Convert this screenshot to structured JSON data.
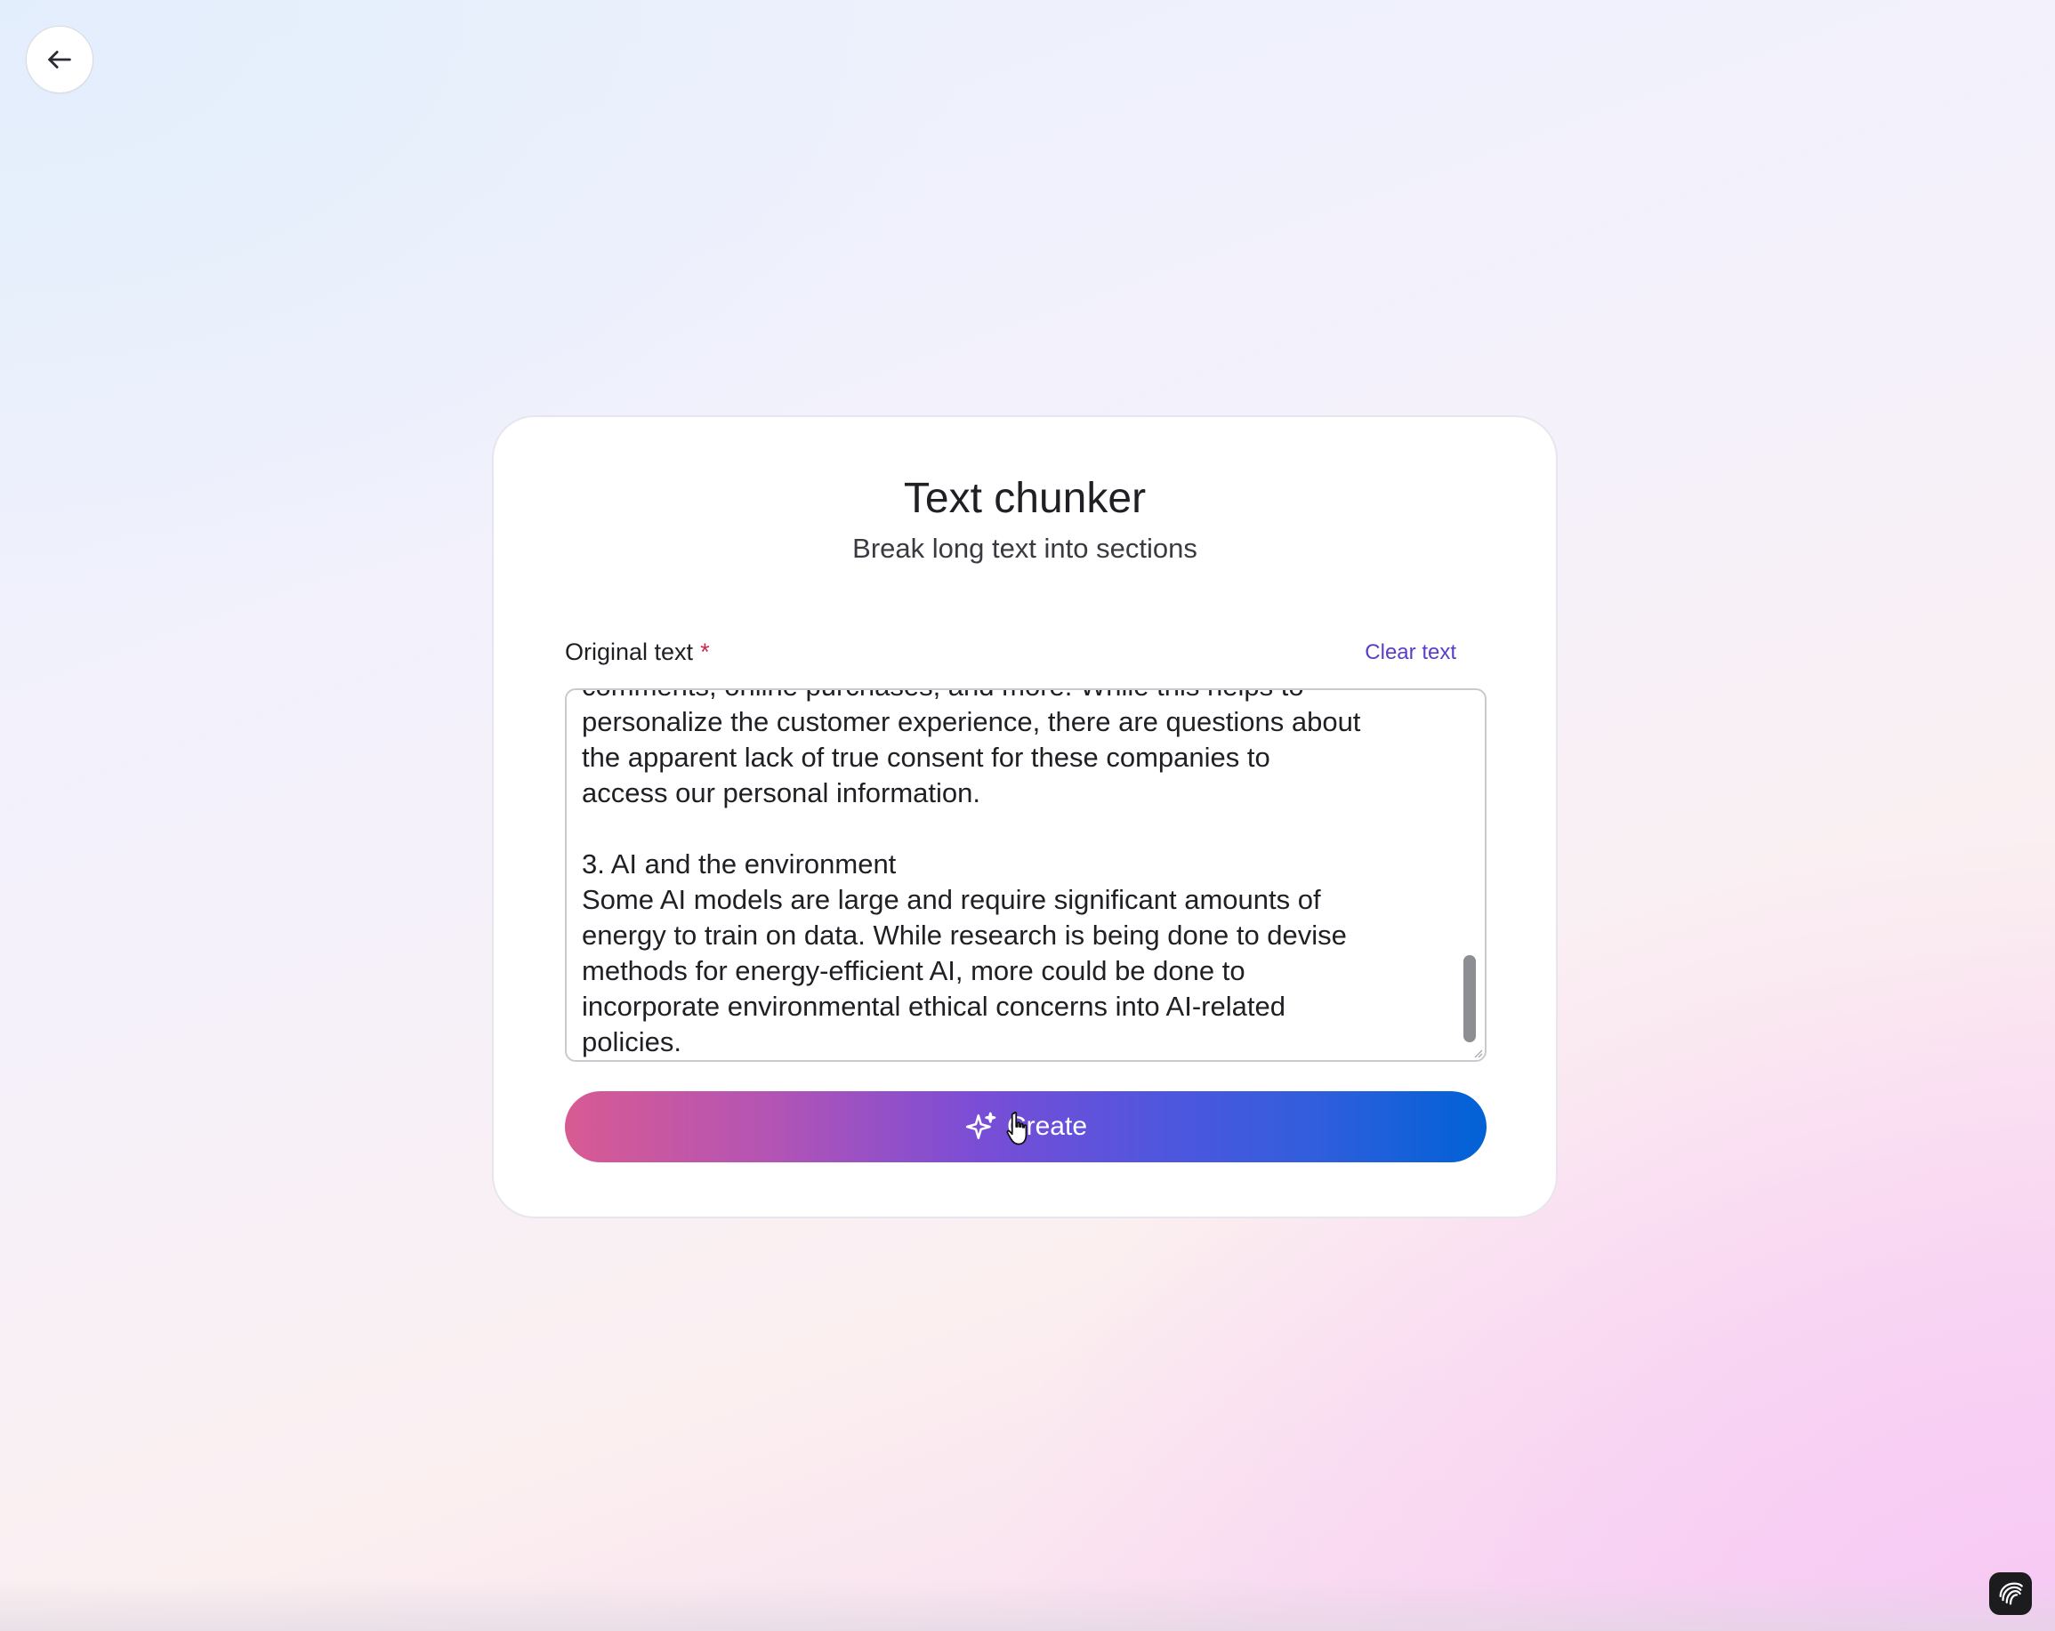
{
  "navigation": {
    "back_icon": "arrow-left-icon"
  },
  "header": {
    "title": "Text chunker",
    "subtitle": "Break long text into sections"
  },
  "form": {
    "field_label": "Original text",
    "required_marker": "*",
    "clear_label": "Clear text",
    "text_value": "comments, online purchases, and more. While this helps to\npersonalize the customer experience, there are questions about\nthe apparent lack of true consent for these companies to\naccess our personal information.\n\n3. AI and the environment\nSome AI models are large and require significant amounts of\nenergy to train on data. While research is being done to devise\nmethods for energy-efficient AI, more could be done to\nincorporate environmental ethical concerns into AI-related\npolicies.",
    "create_label": "Create",
    "create_icon": "sparkles-icon"
  },
  "colors": {
    "accent": "#5a3dc9",
    "required": "#c42a4f",
    "gradient_start": "#d85a92",
    "gradient_end": "#0062d6"
  },
  "corner_icon": "app-logo-icon"
}
